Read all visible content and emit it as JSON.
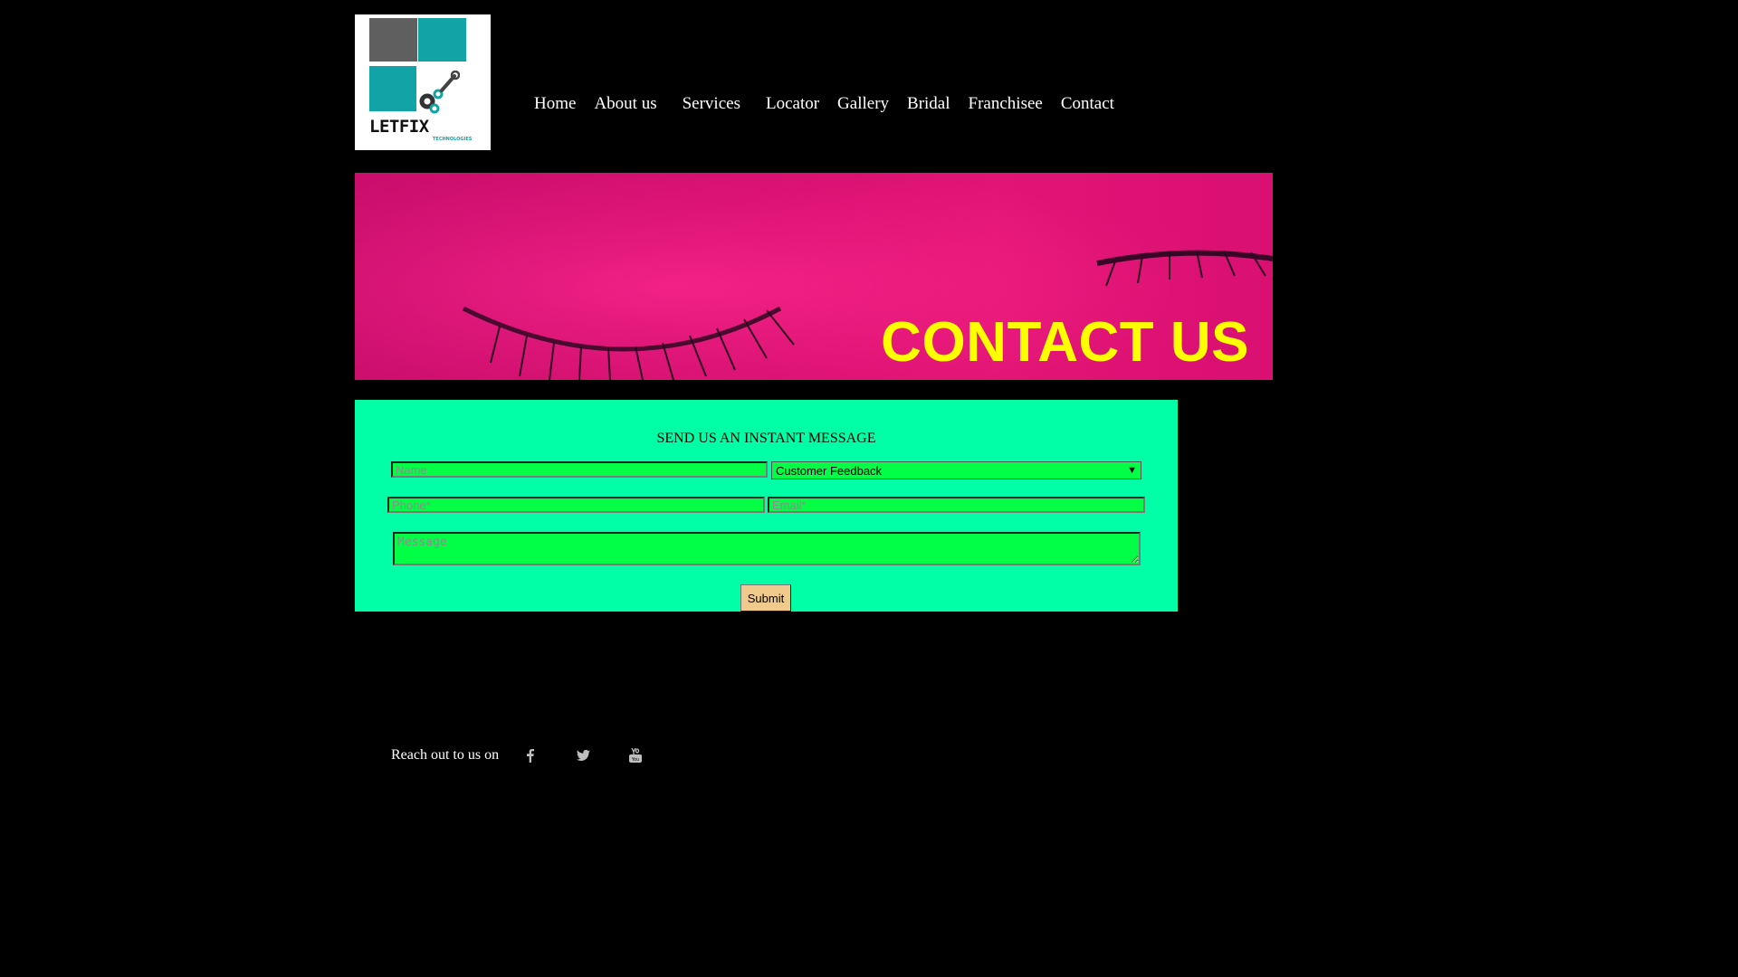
{
  "logo": {
    "brand": "LETFIX",
    "tagline": "TECHNOLOGIES",
    "colors": {
      "gray": "#5f5f5f",
      "teal": "#12a3a6"
    }
  },
  "nav": {
    "items": [
      "Home",
      "About us",
      "Services",
      "Locator",
      "Gallery",
      "Bridal",
      "Franchisee",
      "Contact"
    ]
  },
  "banner": {
    "title": "CONTACT US",
    "background": "#f0157f",
    "title_color": "#ffff00"
  },
  "form": {
    "title": "SEND US AN INSTANT MESSAGE",
    "name_placeholder": "Name",
    "subject_selected": "Customer Feedback",
    "phone_placeholder": "Phone*",
    "email_placeholder": "Email*",
    "message_placeholder": "Message",
    "submit_label": "Submit",
    "panel_color": "#00ffa6",
    "field_color": "#00ff45"
  },
  "footer": {
    "reach_text": "Reach out to us on",
    "social_icons": [
      "facebook-icon",
      "twitter-icon",
      "youtube-icon"
    ]
  }
}
